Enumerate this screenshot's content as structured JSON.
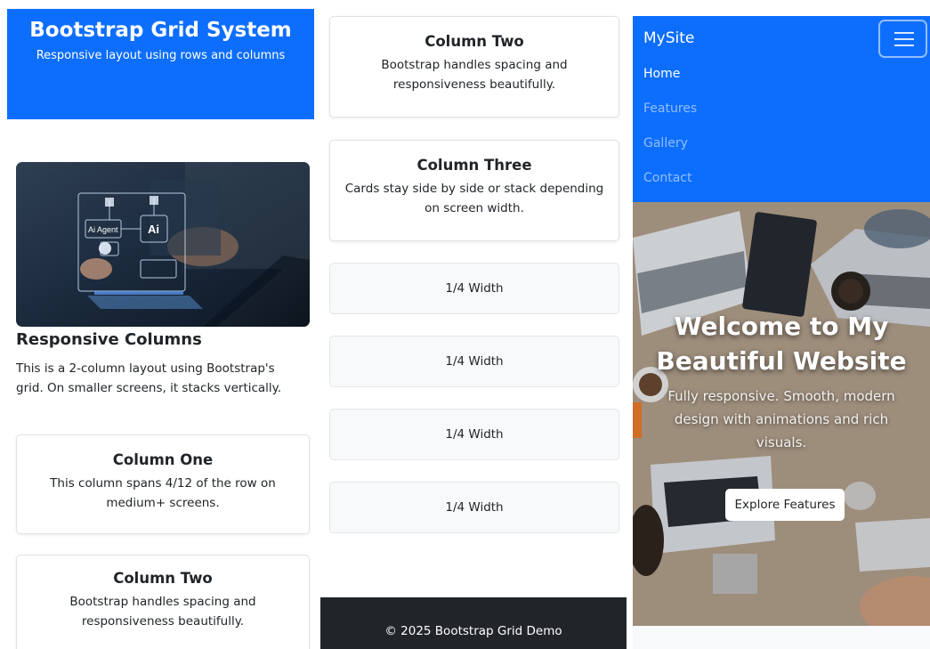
{
  "left": {
    "header": {
      "title": "Bootstrap Grid System",
      "subtitle": "Responsive layout using rows and columns"
    },
    "image_labels": {
      "agent": "Ai Agent",
      "ai": "Ai"
    },
    "section_title": "Responsive Columns",
    "section_desc": "This is a 2-column layout using Bootstrap's grid. On smaller screens, it stacks vertically.",
    "cards": [
      {
        "title": "Column One",
        "text": "This column spans 4/12 of the row on medium+ screens."
      },
      {
        "title": "Column Two",
        "text": "Bootstrap handles spacing and responsiveness beautifully."
      }
    ]
  },
  "middle": {
    "cards": [
      {
        "title": "Column Two",
        "text": "Bootstrap handles spacing and responsiveness beautifully."
      },
      {
        "title": "Column Three",
        "text": "Cards stay side by side or stack depending on screen width."
      }
    ],
    "quarters": [
      "1/4 Width",
      "1/4 Width",
      "1/4 Width",
      "1/4 Width"
    ],
    "footer": "© 2025 Bootstrap Grid Demo"
  },
  "right": {
    "brand": "MySite",
    "nav": [
      "Home",
      "Features",
      "Gallery",
      "Contact"
    ],
    "hero": {
      "title": "Welcome to My Beautiful Website",
      "subtitle": "Fully responsive. Smooth, modern design with animations and rich visuals.",
      "button": "Explore Features"
    }
  },
  "colors": {
    "primary": "#0d6efd",
    "dark": "#212529",
    "light": "#f8f9fa"
  },
  "icons": {
    "toggler": "hamburger-menu-icon"
  }
}
